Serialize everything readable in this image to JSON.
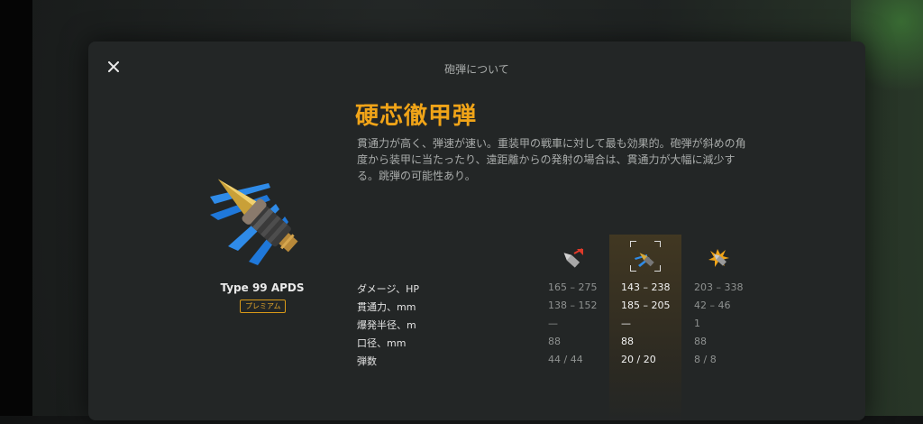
{
  "modal": {
    "title": "砲弾について"
  },
  "shell": {
    "name_jp": "硬芯徹甲弾",
    "description": "貫通力が高く、弾速が速い。重装甲の戦車に対して最も効果的。砲弾が斜めの角度から装甲に当たったり、遠距離からの発射の場合は、貫通力が大幅に減少する。跳弾の可能性あり。",
    "name": "Type 99 APDS",
    "badge": "プレミアム"
  },
  "columns": [
    {
      "icon": "ap-shell-icon"
    },
    {
      "icon": "apds-shell-icon",
      "selected": true
    },
    {
      "icon": "he-shell-icon"
    }
  ],
  "stats": [
    {
      "label": "ダメージ、HP",
      "values": [
        "165 – 275",
        "143 – 238",
        "203 – 338"
      ]
    },
    {
      "label": "貫通力、mm",
      "values": [
        "138 – 152",
        "185 – 205",
        "42 – 46"
      ]
    },
    {
      "label": "爆発半径、m",
      "values": [
        "—",
        "—",
        "1"
      ]
    },
    {
      "label": "口径、mm",
      "values": [
        "88",
        "88",
        "88"
      ]
    },
    {
      "label": "弾数",
      "values": [
        "44 / 44",
        "20 / 20",
        "8 / 8"
      ]
    }
  ],
  "colors": {
    "accent": "#f0a418",
    "modal_bg": "#232626",
    "selected_column": "#5a461e"
  }
}
